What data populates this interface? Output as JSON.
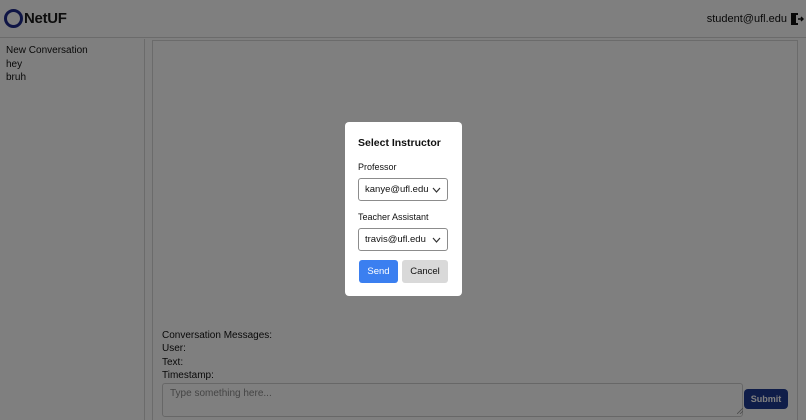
{
  "header": {
    "logo_text": "NetUF",
    "user_email": "student@ufl.edu",
    "logout_icon": "logout-door-icon"
  },
  "sidebar": {
    "conversations": [
      {
        "label": "New Conversation"
      },
      {
        "label": "hey"
      },
      {
        "label": "bruh"
      }
    ]
  },
  "main": {
    "info": {
      "messages_label": "Conversation Messages:",
      "user_label": "User:",
      "text_label": "Text:",
      "timestamp_label": "Timestamp:"
    },
    "input_placeholder": "Type something here...",
    "submit_label": "Submit"
  },
  "modal": {
    "title": "Select Instructor",
    "professor_label": "Professor",
    "professor_value": "kanye@ufl.edu",
    "ta_label": "Teacher Assistant",
    "ta_value": "travis@ufl.edu",
    "send_label": "Send",
    "cancel_label": "Cancel"
  },
  "colors": {
    "brand": "#1e2a8a",
    "submit": "#1f3a93",
    "send": "#3b7ff0",
    "cancel": "#d9d9d9",
    "overlay": "rgba(0,0,0,0.5)"
  }
}
